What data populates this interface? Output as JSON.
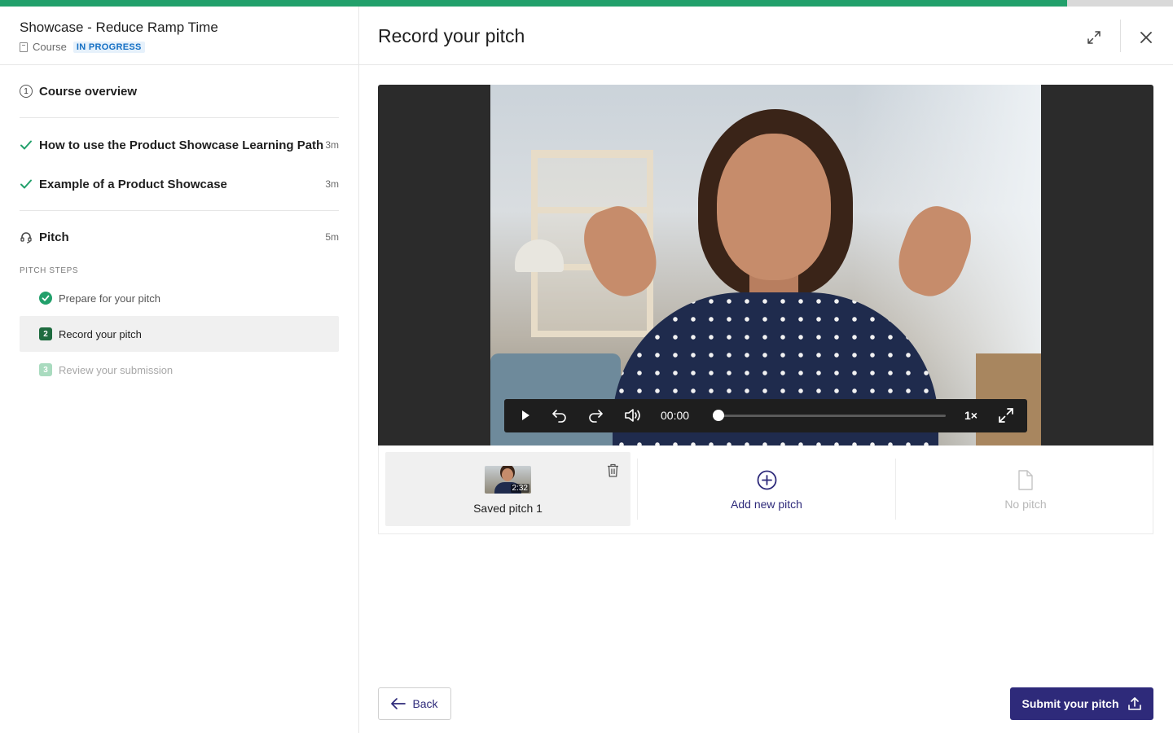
{
  "progress": {
    "fraction": 0.91,
    "color": "#22a06b"
  },
  "course": {
    "title": "Showcase - Reduce Ramp Time",
    "type_label": "Course",
    "status_badge": "IN PROGRESS"
  },
  "sidebar": {
    "items": [
      {
        "label": "Course overview",
        "icon": "number-circle-icon",
        "number": "1",
        "duration": ""
      },
      {
        "label": "How to use the Product Showcase Learning Path",
        "icon": "check-icon",
        "duration": "3m"
      },
      {
        "label": "Example of a Product Showcase",
        "icon": "check-icon",
        "duration": "3m"
      },
      {
        "label": "Pitch",
        "icon": "headset-icon",
        "duration": "5m"
      }
    ],
    "steps_heading": "PITCH STEPS",
    "steps": [
      {
        "label": "Prepare for your pitch",
        "icon": "check-circle-icon",
        "state": "done"
      },
      {
        "label": "Record your pitch",
        "number": "2",
        "state": "active"
      },
      {
        "label": "Review your submission",
        "number": "3",
        "state": "disabled"
      }
    ]
  },
  "main": {
    "title": "Record your pitch",
    "player": {
      "current_time": "00:00",
      "speed": "1×",
      "position_fraction": 0.0
    },
    "pitches": {
      "saved": {
        "label": "Saved pitch 1",
        "duration": "2:32"
      },
      "add_label": "Add new pitch",
      "empty_label": "No pitch"
    },
    "back_label": "Back",
    "submit_label": "Submit your pitch"
  },
  "colors": {
    "accent": "#2e2a7a",
    "success": "#22a06b",
    "badge_bg": "#e6f1fb",
    "badge_text": "#1570c4"
  }
}
